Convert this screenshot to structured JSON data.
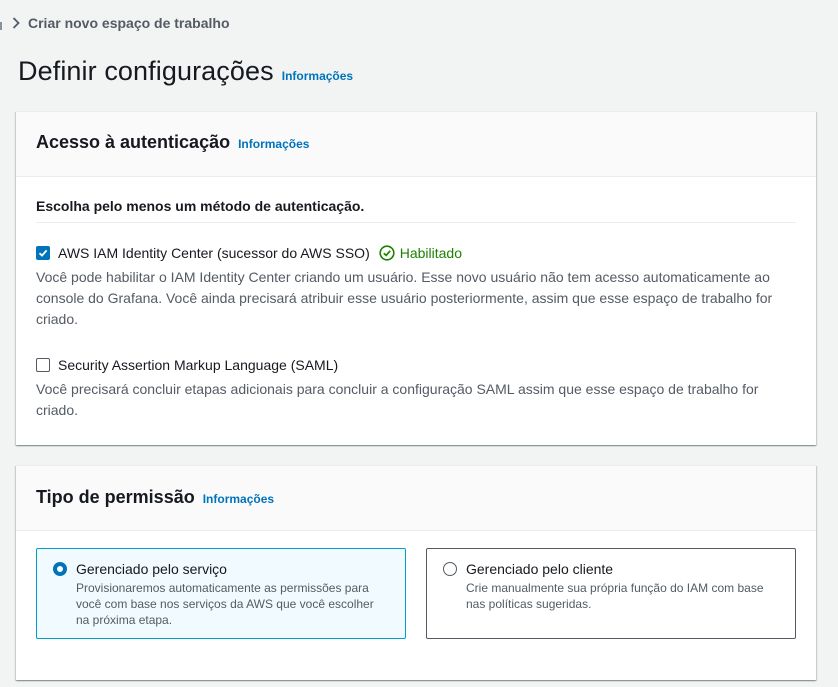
{
  "breadcrumb": {
    "current": "Criar novo espaço de trabalho"
  },
  "page": {
    "title": "Definir configurações",
    "info": "Informações"
  },
  "auth_panel": {
    "title": "Acesso à autenticação",
    "info": "Informações",
    "form_label": "Escolha pelo menos um método de autenticação.",
    "options": [
      {
        "label": "AWS IAM Identity Center (sucessor do AWS SSO)",
        "checked": true,
        "status": "Habilitado",
        "description": "Você pode habilitar o IAM Identity Center criando um usuário. Esse novo usuário não tem acesso automaticamente ao console do Grafana. Você ainda precisará atribuir esse usuário posteriormente, assim que esse espaço de trabalho for criado."
      },
      {
        "label": "Security Assertion Markup Language (SAML)",
        "checked": false,
        "description": "Você precisará concluir etapas adicionais para concluir a configuração SAML assim que esse espaço de trabalho for criado."
      }
    ]
  },
  "permission_panel": {
    "title": "Tipo de permissão",
    "info": "Informações",
    "tiles": [
      {
        "title": "Gerenciado pelo serviço",
        "selected": true,
        "description": "Provisionaremos automaticamente as permissões para você com base nos serviços da AWS que você escolher na próxima etapa."
      },
      {
        "title": "Gerenciado pelo cliente",
        "selected": false,
        "description": "Crie manualmente sua própria função do IAM com base nas políticas sugeridas."
      }
    ]
  },
  "colors": {
    "link": "#0073bb",
    "success": "#1d8102",
    "selected_tile_bg": "#f1faff",
    "selected_tile_border": "#00a1c9",
    "page_bg": "#f2f3f3"
  },
  "icons": {
    "breadcrumb_separator": "chevron-right-icon",
    "status": "check-circle-icon",
    "checkbox_checked": "checkmark-icon"
  }
}
